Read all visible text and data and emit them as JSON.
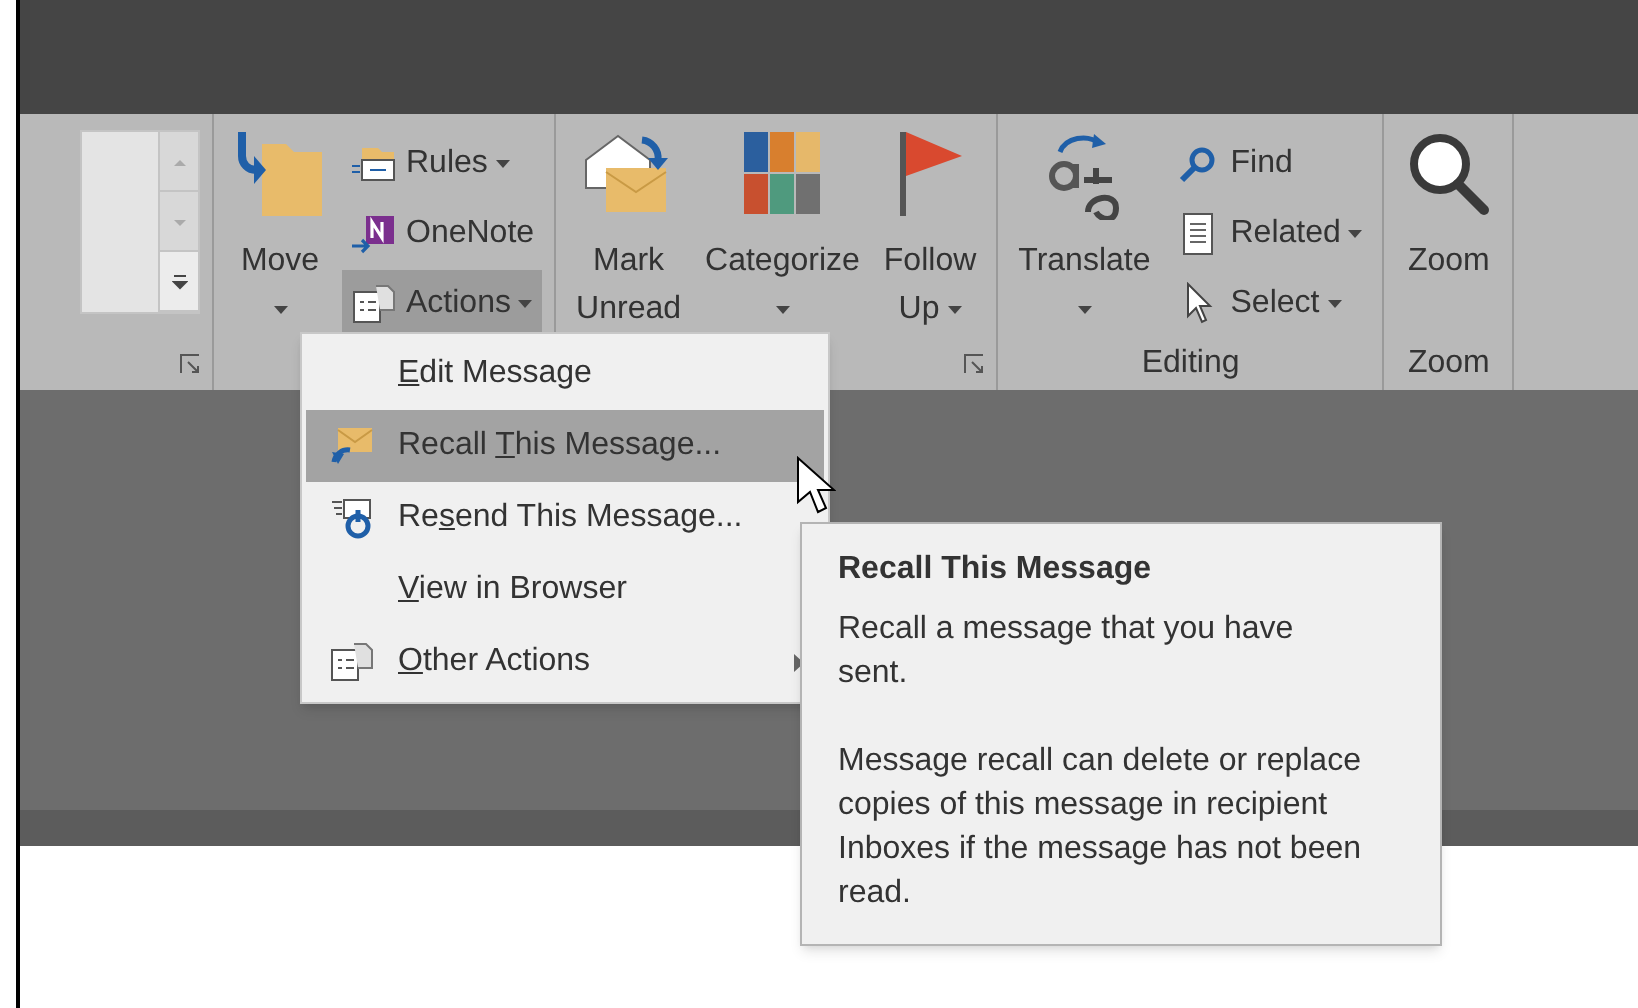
{
  "ribbon": {
    "groups": [
      {
        "launcher": true,
        "items": [
          {
            "kind": "gallery"
          }
        ]
      },
      {
        "launcher": false,
        "items": [
          {
            "kind": "large",
            "lines": [
              "Move"
            ],
            "dropdown": true
          },
          {
            "kind": "stack",
            "buttons": [
              {
                "label": "Rules",
                "dropdown": true,
                "selected": false
              },
              {
                "label": "OneNote",
                "dropdown": false,
                "selected": false
              },
              {
                "label": "Actions",
                "dropdown": true,
                "selected": true
              }
            ]
          }
        ]
      },
      {
        "launcher": true,
        "items": [
          {
            "kind": "large",
            "lines": [
              "Mark",
              "Unread"
            ],
            "dropdown": false
          },
          {
            "kind": "large",
            "lines": [
              "Categorize"
            ],
            "dropdown": true
          },
          {
            "kind": "large",
            "lines": [
              "Follow",
              "Up"
            ],
            "dropdown": true
          }
        ]
      },
      {
        "label": "Editing",
        "launcher": false,
        "items": [
          {
            "kind": "large",
            "lines": [
              "Translate"
            ],
            "dropdown": true
          },
          {
            "kind": "stack",
            "buttons": [
              {
                "label": "Find",
                "dropdown": false,
                "selected": false
              },
              {
                "label": "Related",
                "dropdown": true,
                "selected": false
              },
              {
                "label": "Select",
                "dropdown": true,
                "selected": false
              }
            ]
          }
        ]
      },
      {
        "label": "Zoom",
        "launcher": false,
        "items": [
          {
            "kind": "large",
            "lines": [
              "Zoom"
            ],
            "dropdown": false
          }
        ]
      }
    ]
  },
  "menu": {
    "items": [
      {
        "key": "E",
        "post": "dit Message",
        "submenu": false,
        "selected": false
      },
      {
        "pre": "Recall ",
        "key": "T",
        "post": "his Message...",
        "submenu": false,
        "selected": true
      },
      {
        "pre": "Re",
        "key": "s",
        "post": "end This Message...",
        "submenu": false,
        "selected": false
      },
      {
        "key": "V",
        "post": "iew in Browser",
        "submenu": false,
        "selected": false
      },
      {
        "key": "O",
        "post": "ther Actions",
        "submenu": true,
        "selected": false
      }
    ]
  },
  "tooltip": {
    "title": "Recall This Message",
    "paragraphs": [
      "Recall a message that you have sent.",
      "Message recall can delete or replace copies of this message in recipient Inboxes if the message has not been read."
    ]
  }
}
